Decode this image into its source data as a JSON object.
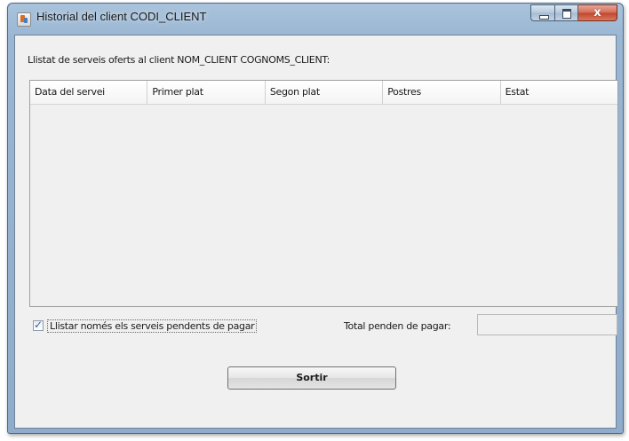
{
  "window": {
    "title": "Historial del client CODI_CLIENT",
    "minimize_icon": "minimize-icon",
    "maximize_icon": "maximize-icon",
    "close_icon": "close-icon",
    "close_glyph": "x"
  },
  "main": {
    "list_label": "Llistat de serveis oferts al client NOM_CLIENT COGNOMS_CLIENT:",
    "table": {
      "columns": [
        "Data del servei",
        "Primer plat",
        "Segon plat",
        "Postres",
        "Estat"
      ],
      "rows": []
    },
    "filter_checkbox": {
      "label": "Llistar només els serveis pendents de pagar",
      "checked": true,
      "check_glyph": "✓"
    },
    "total": {
      "label": "Total penden de pagar:",
      "value": ""
    },
    "exit_button_label": "Sortir"
  },
  "colors": {
    "title_bar": "#9ab6d2",
    "close_button": "#c0452c",
    "client_background": "#f0f0f0"
  }
}
